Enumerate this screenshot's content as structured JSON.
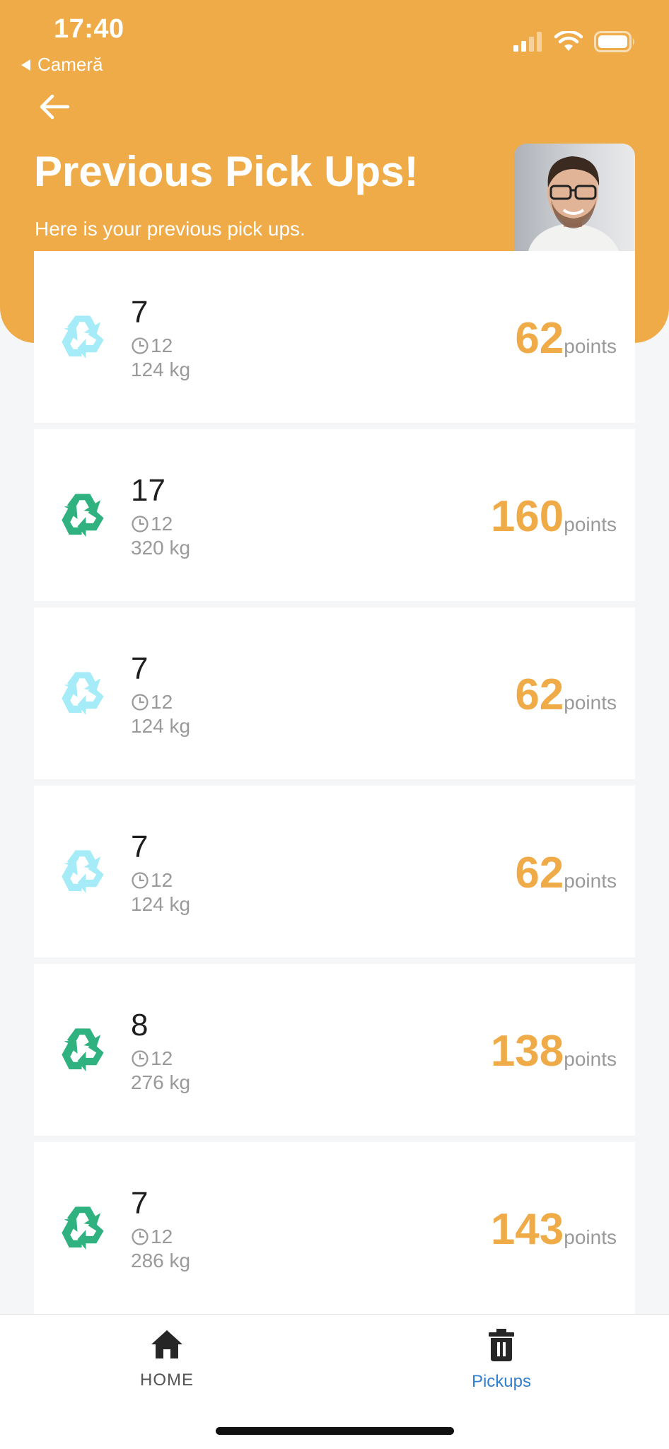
{
  "status_bar": {
    "time": "17:40",
    "back_app": "Cameră",
    "icons": [
      "signal-icon",
      "wifi-icon",
      "battery-icon"
    ]
  },
  "header": {
    "title": "Previous Pick Ups!",
    "subtitle": "Here is your previous pick ups.",
    "avatar": "user-avatar"
  },
  "colors": {
    "accent": "#efab48",
    "recycle_light": "#a6ecf8",
    "recycle_dark": "#2fb27f",
    "active_nav": "#2f80d1"
  },
  "pickups": [
    {
      "qty": "7",
      "time": "12",
      "weight": "124 kg",
      "points": "62",
      "unit": "points",
      "icon": "recycle-light-icon"
    },
    {
      "qty": "17",
      "time": "12",
      "weight": "320 kg",
      "points": "160",
      "unit": "points",
      "icon": "recycle-dark-icon"
    },
    {
      "qty": "7",
      "time": "12",
      "weight": "124 kg",
      "points": "62",
      "unit": "points",
      "icon": "recycle-light-icon"
    },
    {
      "qty": "7",
      "time": "12",
      "weight": "124 kg",
      "points": "62",
      "unit": "points",
      "icon": "recycle-light-icon"
    },
    {
      "qty": "8",
      "time": "12",
      "weight": "276 kg",
      "points": "138",
      "unit": "points",
      "icon": "recycle-dark-icon"
    },
    {
      "qty": "7",
      "time": "12",
      "weight": "286 kg",
      "points": "143",
      "unit": "points",
      "icon": "recycle-dark-icon"
    }
  ],
  "nav": {
    "home_label": "HOME",
    "pickups_label": "Pickups",
    "active": "pickups"
  }
}
